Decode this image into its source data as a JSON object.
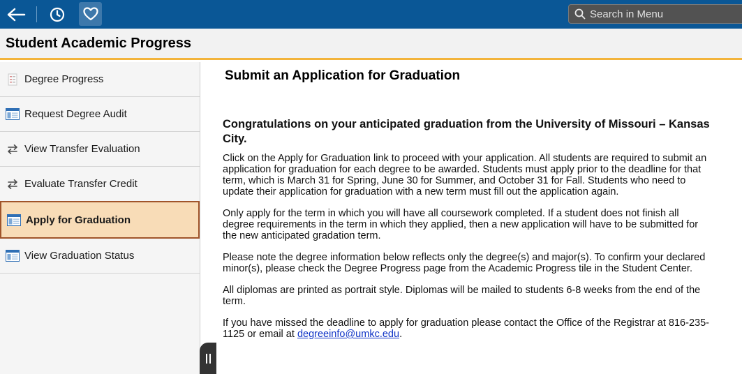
{
  "topbar": {
    "back_icon": "back-arrow-icon",
    "history_icon": "clock-icon",
    "favorites_icon": "heart-icon",
    "search_placeholder": "Search in Menu"
  },
  "header": {
    "title": "Student Academic Progress"
  },
  "sidebar": {
    "items": [
      {
        "label": "Degree Progress",
        "icon": "report-icon"
      },
      {
        "label": "Request Degree Audit",
        "icon": "window-icon"
      },
      {
        "label": "View Transfer Evaluation",
        "icon": "transfer-arrows-icon"
      },
      {
        "label": "Evaluate Transfer Credit",
        "icon": "transfer-arrows-icon"
      },
      {
        "label": "Apply for Graduation",
        "icon": "window-icon",
        "active": true
      },
      {
        "label": "View Graduation Status",
        "icon": "window-icon"
      }
    ]
  },
  "main": {
    "title": "Submit an Application for Graduation",
    "heading": "Congratulations on your anticipated graduation from the University of Missouri – Kansas City.",
    "paragraphs": [
      "Click on the Apply for Graduation link to proceed with your application. All students are required to submit an application for graduation for each degree to be awarded. Students must apply prior to the deadline for that term, which is March 31 for Spring, June 30 for Summer, and October 31 for Fall. Students who need to update their application for graduation with a new term must fill out the application again.",
      "Only apply for the term in which you will have all coursework completed. If a student does not finish all degree requirements in the term in which they applied, then a new application will have to be submitted for the new anticipated gradation term.",
      "Please note the degree information below reflects only the degree(s) and major(s). To confirm your declared minor(s), please check the Degree Progress page from the Academic Progress tile in the Student Center.",
      "All diplomas are printed as portrait style. Diplomas will be mailed to students 6-8 weeks from the end of the term."
    ],
    "contact_text": "If you have missed the deadline to apply for graduation please contact the Office of the Registrar at 816-235-1125 or email at ",
    "contact_email": "degreeinfo@umkc.edu",
    "contact_end": "."
  },
  "colors": {
    "topbar": "#0a5796",
    "header_accent": "#f3b43c",
    "active_bg": "#f8dcb7",
    "active_border": "#a0542a",
    "link": "#1034c6"
  }
}
